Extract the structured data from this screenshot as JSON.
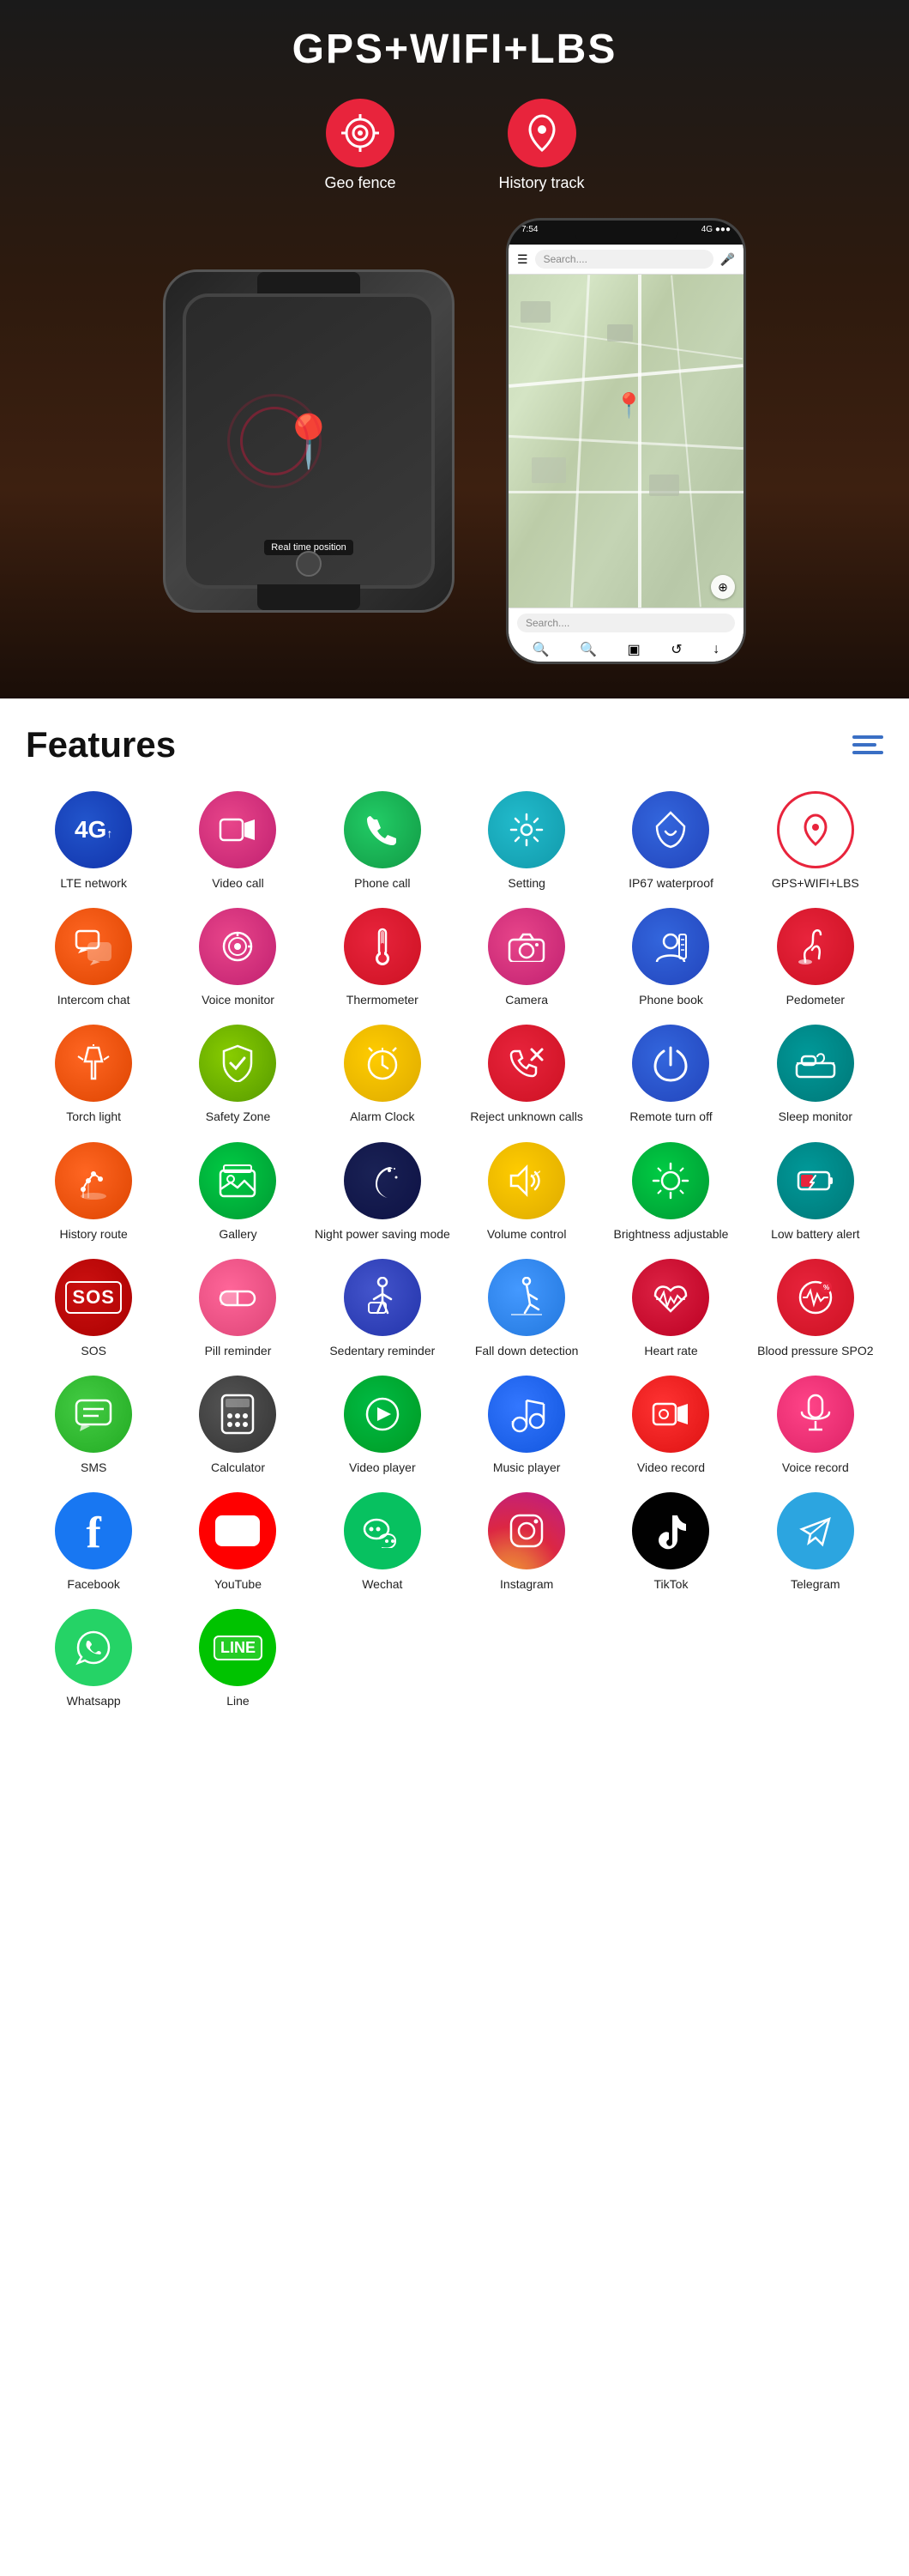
{
  "hero": {
    "title": "GPS+WIFI+LBS",
    "gps_icons": [
      {
        "label": "Geo fence",
        "icon": "🎯"
      },
      {
        "label": "History track",
        "icon": "📍"
      }
    ],
    "watch_label": "Real time position",
    "phone_search": "Search....",
    "map_pin": "📍"
  },
  "features": {
    "title": "Features",
    "menu_icon": "≡",
    "items": [
      {
        "label": "LTE network",
        "icon": "4G",
        "bg": "bg-blue-dark",
        "type": "text"
      },
      {
        "label": "Video call",
        "icon": "📹",
        "bg": "bg-pink",
        "type": "emoji"
      },
      {
        "label": "Phone call",
        "icon": "📞",
        "bg": "bg-green",
        "type": "emoji"
      },
      {
        "label": "Setting",
        "icon": "⚙️",
        "bg": "bg-teal",
        "type": "emoji"
      },
      {
        "label": "IP67 waterproof",
        "icon": "🌊",
        "bg": "bg-blue-mid",
        "type": "emoji"
      },
      {
        "label": "GPS+WIFI+LBS",
        "icon": "📍",
        "bg": "bg-red-outline",
        "type": "emoji"
      },
      {
        "label": "Intercom chat",
        "icon": "💬",
        "bg": "bg-orange",
        "type": "emoji"
      },
      {
        "label": "Voice monitor",
        "icon": "🎧",
        "bg": "bg-pink",
        "type": "emoji"
      },
      {
        "label": "Thermometer",
        "icon": "🌡️",
        "bg": "bg-red",
        "type": "emoji"
      },
      {
        "label": "Camera",
        "icon": "📷",
        "bg": "bg-pink",
        "type": "emoji"
      },
      {
        "label": "Phone book",
        "icon": "👤",
        "bg": "bg-blue-mid",
        "type": "emoji"
      },
      {
        "label": "Pedometer",
        "icon": "🏃",
        "bg": "bg-red",
        "type": "emoji"
      },
      {
        "label": "Torch light",
        "icon": "🔦",
        "bg": "bg-orange",
        "type": "emoji"
      },
      {
        "label": "Safety Zone",
        "icon": "🛡️",
        "bg": "bg-green-lime",
        "type": "emoji"
      },
      {
        "label": "Alarm Clock",
        "icon": "⏰",
        "bg": "bg-yellow",
        "type": "emoji"
      },
      {
        "label": "Reject unknown calls",
        "icon": "🚫",
        "bg": "bg-red",
        "type": "emoji"
      },
      {
        "label": "Remote turn off",
        "icon": "🖐️",
        "bg": "bg-blue-mid",
        "type": "emoji"
      },
      {
        "label": "Sleep monitor",
        "icon": "🛏️",
        "bg": "bg-teal2",
        "type": "emoji"
      },
      {
        "label": "History route",
        "icon": "👣",
        "bg": "bg-orange",
        "type": "emoji"
      },
      {
        "label": "Gallery",
        "icon": "🖼️",
        "bg": "bg-green-bright",
        "type": "emoji"
      },
      {
        "label": "Night power saving mode",
        "icon": "🌙",
        "bg": "bg-dark-navy",
        "type": "emoji"
      },
      {
        "label": "Volume control",
        "icon": "🔊",
        "bg": "bg-yellow",
        "type": "emoji"
      },
      {
        "label": "Brightness adjustable",
        "icon": "☀️",
        "bg": "bg-green-bright",
        "type": "emoji"
      },
      {
        "label": "Low battery alert",
        "icon": "🔋",
        "bg": "bg-teal2",
        "type": "emoji"
      },
      {
        "label": "SOS",
        "icon": "SOS",
        "bg": "bg-red-sos",
        "type": "text"
      },
      {
        "label": "Pill reminder",
        "icon": "💊",
        "bg": "bg-pink2",
        "type": "emoji"
      },
      {
        "label": "Sedentary reminder",
        "icon": "🪑",
        "bg": "bg-indigo",
        "type": "emoji"
      },
      {
        "label": "Fall down detection",
        "icon": "🚶",
        "bg": "bg-blue-light",
        "type": "emoji"
      },
      {
        "label": "Heart rate",
        "icon": "❤️",
        "bg": "bg-red2",
        "type": "emoji"
      },
      {
        "label": "Blood pressure SPO2",
        "icon": "🩺",
        "bg": "bg-red",
        "type": "emoji"
      },
      {
        "label": "SMS",
        "icon": "💬",
        "bg": "bg-chat-green",
        "type": "emoji"
      },
      {
        "label": "Calculator",
        "icon": "🧮",
        "bg": "bg-dark-gray",
        "type": "emoji"
      },
      {
        "label": "Video player",
        "icon": "▶️",
        "bg": "bg-green3",
        "type": "emoji"
      },
      {
        "label": "Music player",
        "icon": "🎵",
        "bg": "bg-blue3",
        "type": "emoji"
      },
      {
        "label": "Video record",
        "icon": "🎥",
        "bg": "bg-red3",
        "type": "emoji"
      },
      {
        "label": "Voice record",
        "icon": "🎤",
        "bg": "bg-pink3",
        "type": "emoji"
      },
      {
        "label": "Facebook",
        "icon": "f",
        "bg": "bg-fb",
        "type": "text"
      },
      {
        "label": "YouTube",
        "icon": "▶",
        "bg": "bg-yt",
        "type": "text"
      },
      {
        "label": "Wechat",
        "icon": "WeChat",
        "bg": "bg-wc",
        "type": "text-sm"
      },
      {
        "label": "Instagram",
        "icon": "📷",
        "bg": "bg-ig",
        "type": "emoji"
      },
      {
        "label": "TikTok",
        "icon": "♪",
        "bg": "bg-tt",
        "type": "text"
      },
      {
        "label": "Telegram",
        "icon": "✈",
        "bg": "bg-tg",
        "type": "text"
      },
      {
        "label": "Whatsapp",
        "icon": "📱",
        "bg": "bg-wa",
        "type": "emoji"
      },
      {
        "label": "Line",
        "icon": "LINE",
        "bg": "bg-line",
        "type": "text-sm"
      }
    ]
  }
}
